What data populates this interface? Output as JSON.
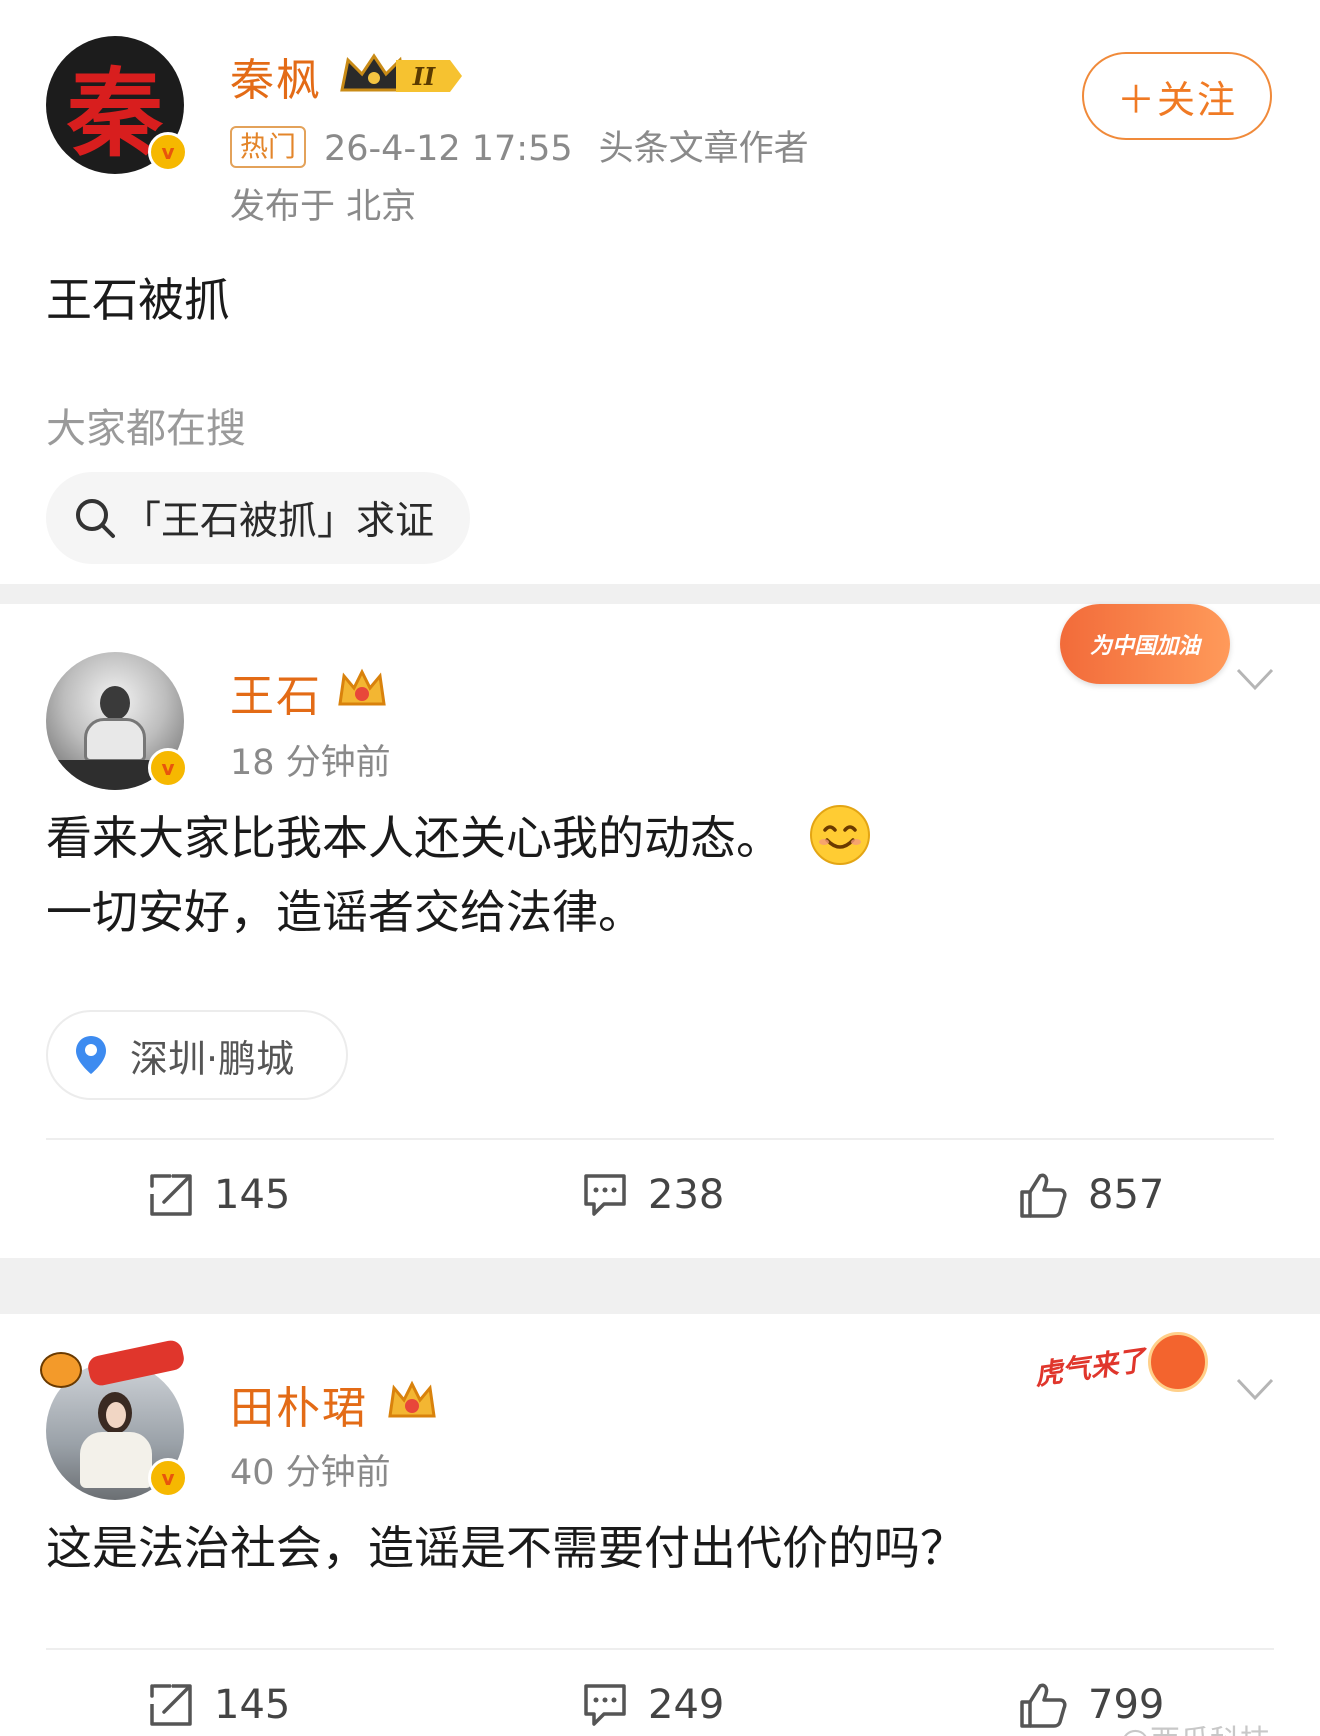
{
  "post1": {
    "author": "秦枫",
    "member_level": "II",
    "hot_tag": "热门",
    "timestamp": "26-4-12 17:55",
    "author_title": "头条文章作者",
    "location_line": "发布于 北京",
    "follow_label": "＋关注",
    "content": "王石被抓",
    "search_section_label": "大家都在搜",
    "search_chip": "「王石被抓」求证",
    "avatar_glyph": "秦"
  },
  "post2": {
    "author": "王石",
    "time_ago": "18 分钟前",
    "content_line1": "看来大家比我本人还关心我的动态。",
    "content_line2": "一切安好，造谣者交给法律。",
    "location_tag": "深圳·鹏城",
    "deco_label": "为中国加油",
    "repost_count": "145",
    "comment_count": "238",
    "like_count": "857"
  },
  "post3": {
    "author": "田朴珺",
    "time_ago": "40 分钟前",
    "content": "这是法治社会，造谣是不需要付出代价的吗？",
    "deco_label": "虎气来了",
    "repost_count": "145",
    "comment_count": "249",
    "like_count": "799"
  },
  "watermark": "@西瓜科技",
  "colors": {
    "name": "#e36b16",
    "follow": "#f07a24",
    "verified": "#f6b800",
    "separator": "#f0f0f0"
  },
  "icons": [
    "search-icon",
    "location-pin-icon",
    "repost-icon",
    "comment-icon",
    "like-icon",
    "chevron-down-icon",
    "crown-icon",
    "smile-emoji-icon",
    "verified-icon"
  ]
}
